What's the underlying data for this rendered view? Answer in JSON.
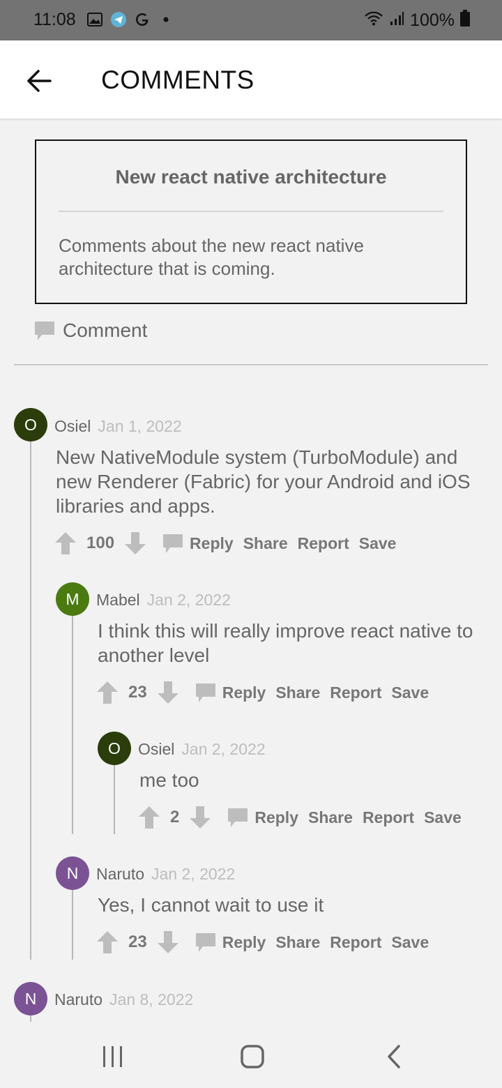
{
  "status": {
    "time": "11:08",
    "battery": "100%"
  },
  "appbar": {
    "title": "COMMENTS"
  },
  "post": {
    "title": "New react native architecture",
    "body_line1": "Comments about the new react native",
    "body_line2": "architecture that is coming."
  },
  "comment_button_label": "Comment",
  "action_labels": {
    "reply": "Reply",
    "share": "Share",
    "report": "Report",
    "save": "Save"
  },
  "colors": {
    "osiel": "#2b3d0a",
    "mabel": "#4a7a10",
    "naruto": "#7b5394"
  },
  "comments": [
    {
      "initial": "O",
      "author": "Osiel",
      "date": "Jan 1, 2022",
      "lines": [
        "New NativeModule system (TurboModule) and",
        "new Renderer (Fabric) for your Android and iOS",
        "libraries and apps."
      ],
      "votes": "100"
    },
    {
      "initial": "M",
      "author": "Mabel",
      "date": "Jan 2, 2022",
      "lines": [
        "I think this will really improve react native to",
        "another level"
      ],
      "votes": "23"
    },
    {
      "initial": "O",
      "author": "Osiel",
      "date": "Jan 2, 2022",
      "lines": [
        "me too"
      ],
      "votes": "2"
    },
    {
      "initial": "N",
      "author": "Naruto",
      "date": "Jan 2, 2022",
      "lines": [
        "Yes, I cannot wait to use it"
      ],
      "votes": "23"
    },
    {
      "initial": "N",
      "author": "Naruto",
      "date": "Jan 8, 2022"
    }
  ]
}
